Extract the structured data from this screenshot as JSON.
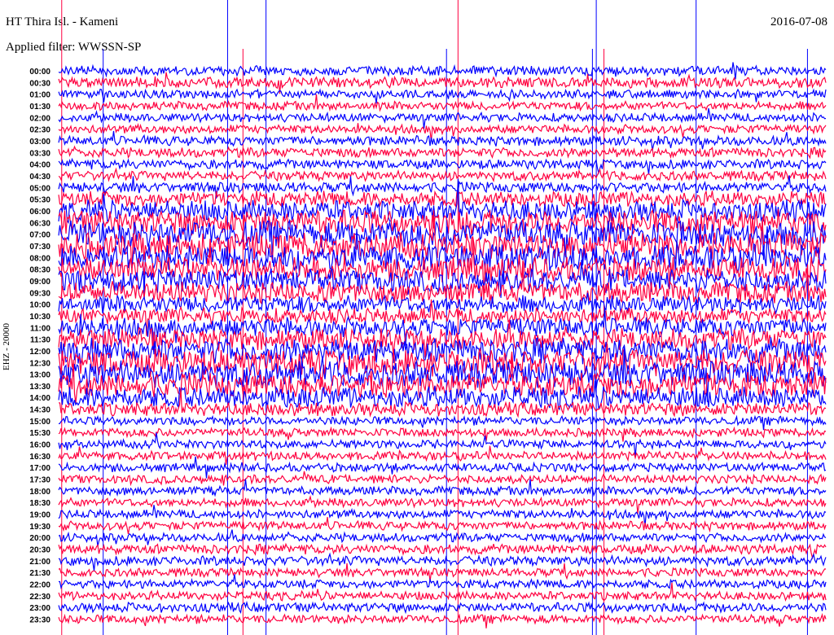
{
  "header": {
    "station": "HT Thira Isl. - Kameni",
    "filter": "Applied filter: WWSSN-SP",
    "date": "2016-07-08",
    "channel": "EHZ - 20000"
  },
  "chart_data": {
    "type": "line",
    "title": "HT Thira Isl. - Kameni",
    "subtitle": "Applied filter: WWSSN-SP",
    "ylabel": "EHZ - 20000",
    "row_minutes": 30,
    "colors": {
      "even": "#0000ff",
      "odd": "#ff0040"
    },
    "row_labels": [
      "00:00",
      "00:30",
      "01:00",
      "01:30",
      "02:00",
      "02:30",
      "03:00",
      "03:30",
      "04:00",
      "04:30",
      "05:00",
      "05:30",
      "06:00",
      "06:30",
      "07:00",
      "07:30",
      "08:00",
      "08:30",
      "09:00",
      "09:30",
      "10:00",
      "10:30",
      "11:00",
      "11:30",
      "12:00",
      "12:30",
      "13:00",
      "13:30",
      "14:00",
      "14:30",
      "15:00",
      "15:30",
      "16:00",
      "16:30",
      "17:00",
      "17:30",
      "18:00",
      "18:30",
      "19:00",
      "19:30",
      "20:00",
      "20:30",
      "21:00",
      "21:30",
      "22:00",
      "22:30",
      "23:00",
      "23:30"
    ],
    "relative_amplitude": [
      1.0,
      1.1,
      0.9,
      0.9,
      0.9,
      0.9,
      1.0,
      1.0,
      1.0,
      1.0,
      1.1,
      1.6,
      2.2,
      2.6,
      2.8,
      2.8,
      2.8,
      2.6,
      2.4,
      2.2,
      1.8,
      1.6,
      2.0,
      2.2,
      2.6,
      2.8,
      2.8,
      2.6,
      2.2,
      1.4,
      0.9,
      0.9,
      0.9,
      0.9,
      0.9,
      0.9,
      0.9,
      0.9,
      0.9,
      0.9,
      0.9,
      1.0,
      1.0,
      0.9,
      0.9,
      0.9,
      1.0,
      0.9
    ],
    "large_spikes_fraction_of_row": [
      0.004,
      0.058,
      0.22,
      0.24,
      0.27,
      0.505,
      0.52,
      0.695,
      0.7,
      0.71,
      0.83,
      0.975
    ]
  }
}
